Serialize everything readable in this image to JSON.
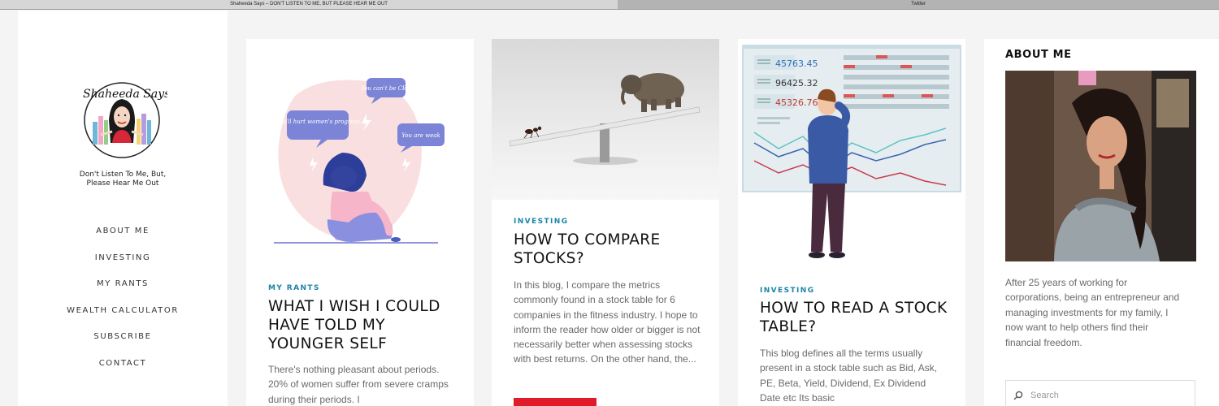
{
  "browser": {
    "tabs": [
      {
        "title": "Shaheeda Says – DON'T LISTEN TO ME, BUT PLEASE HEAR ME OUT"
      },
      {
        "title": "Twitter"
      }
    ]
  },
  "sidebar": {
    "logo_text": "Shaheeda Says",
    "tagline_line1": "Don't Listen To Me, But,",
    "tagline_line2": "Please Hear Me Out",
    "nav": [
      {
        "label": "ABOUT ME"
      },
      {
        "label": "INVESTING"
      },
      {
        "label": "MY RANTS"
      },
      {
        "label": "WEALTH CALCULATOR"
      },
      {
        "label": "SUBSCRIBE"
      },
      {
        "label": "CONTACT"
      }
    ]
  },
  "posts": [
    {
      "category": "MY RANTS",
      "title": "WHAT I WISH I COULD HAVE TOLD MY YOUNGER SELF",
      "excerpt": "There's nothing pleasant about periods. 20% of women suffer from severe cramps during their periods. I",
      "bubbles": [
        "You'll hurt women's progress",
        "You can't be CEO",
        "You are weak"
      ]
    },
    {
      "category": "INVESTING",
      "title": "HOW TO COMPARE STOCKS?",
      "excerpt": "In this blog, I compare the metrics commonly found in a stock table for 6 companies in the fitness industry. I hope to inform the reader how older or bigger is not necessarily better when assessing stocks with best returns. On the other hand, the..."
    },
    {
      "category": "INVESTING",
      "title": "HOW TO READ A STOCK TABLE?",
      "excerpt": "This blog defines all the terms usually present in a stock table such as Bid, Ask, PE, Beta, Yield, Dividend, Ex Dividend Date etc Its basic",
      "ticker_values": [
        "45763.45",
        "96425.32",
        "45326.76"
      ]
    }
  ],
  "about": {
    "heading": "ABOUT ME",
    "text": "After 25 years of working for corporations, being an entrepreneur and managing investments for my family, I now want to help others find their financial freedom."
  },
  "search": {
    "placeholder": "Search",
    "value": ""
  },
  "colors": {
    "accent_category": "#1b85a8",
    "button_red": "#e01b2a",
    "background": "#f4f4f4"
  }
}
